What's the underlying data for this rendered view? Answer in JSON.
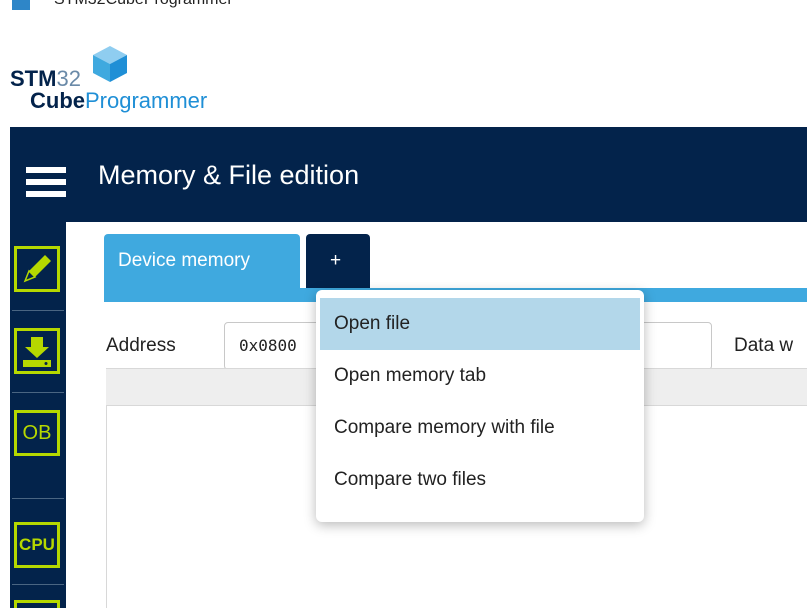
{
  "window": {
    "title": "STM32CubeProgrammer"
  },
  "logo": {
    "brand_bold": "STM",
    "brand_light": "32",
    "product_bold": "Cube",
    "product_light": "Programmer"
  },
  "header": {
    "title": "Memory & File edition"
  },
  "sidebar": {
    "items": [
      {
        "name": "memory-edit",
        "icon": "pencil-icon",
        "label": ""
      },
      {
        "name": "erasing-programming",
        "icon": "download-icon",
        "label": ""
      },
      {
        "name": "option-bytes",
        "icon": "ob-icon",
        "label": "OB"
      },
      {
        "name": "cpu",
        "icon": "cpu-icon",
        "label": "CPU"
      }
    ]
  },
  "tabs": {
    "device_memory": "Device memory",
    "add": "+"
  },
  "toolbar": {
    "address_label": "Address",
    "address_value": "0x0800",
    "data_width_label": "Data w"
  },
  "menu": {
    "items": [
      {
        "label": "Open file",
        "active": true
      },
      {
        "label": "Open memory tab",
        "active": false
      },
      {
        "label": "Compare memory with file",
        "active": false
      },
      {
        "label": "Compare two files",
        "active": false
      }
    ]
  },
  "colors": {
    "navy": "#03234b",
    "tab_blue": "#3fa9df",
    "accent_green": "#b6d800",
    "menu_highlight": "#b3d7ea"
  }
}
